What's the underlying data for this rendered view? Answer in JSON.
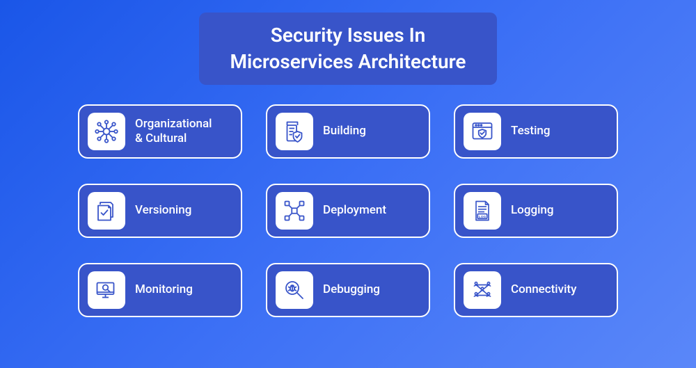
{
  "title": {
    "line1": "Security Issues In",
    "line2": "Microservices Architecture"
  },
  "colors": {
    "accent": "#3854c9",
    "icon_stroke": "#3854c9",
    "text": "#ffffff"
  },
  "items": [
    {
      "id": "org-cultural",
      "label": "Organizational\n& Cultural",
      "icon": "network-icon"
    },
    {
      "id": "building",
      "label": "Building",
      "icon": "building-shield-icon"
    },
    {
      "id": "testing",
      "label": "Testing",
      "icon": "browser-shield-icon"
    },
    {
      "id": "versioning",
      "label": "Versioning",
      "icon": "docs-check-icon"
    },
    {
      "id": "deployment",
      "label": "Deployment",
      "icon": "nodes-grid-icon"
    },
    {
      "id": "logging",
      "label": "Logging",
      "icon": "log-file-icon"
    },
    {
      "id": "monitoring",
      "label": "Monitoring",
      "icon": "monitor-search-icon"
    },
    {
      "id": "debugging",
      "label": "Debugging",
      "icon": "bug-search-icon"
    },
    {
      "id": "connectivity",
      "label": "Connectivity",
      "icon": "people-network-icon"
    }
  ]
}
